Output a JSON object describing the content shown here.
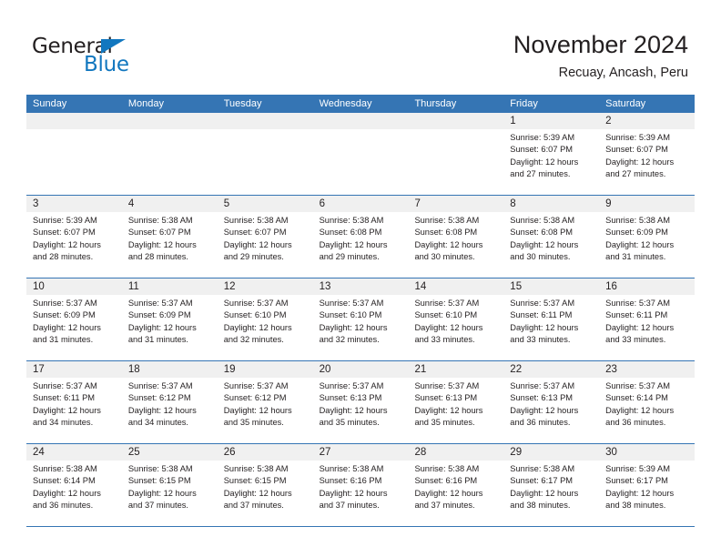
{
  "brand": {
    "name_part1": "General",
    "name_part2": "Blue",
    "triangle_icon": "triangle-icon",
    "accent_color": "#1277bf"
  },
  "header": {
    "title": "November 2024",
    "subtitle": "Recuay, Ancash, Peru"
  },
  "theme": {
    "header_band": "#3575b4",
    "day_band": "#f0f0f0",
    "text": "#231f20"
  },
  "weekdays": [
    "Sunday",
    "Monday",
    "Tuesday",
    "Wednesday",
    "Thursday",
    "Friday",
    "Saturday"
  ],
  "weeks": [
    [
      {
        "day": "",
        "empty": true,
        "sunrise": "",
        "sunset": "",
        "daylight1": "",
        "daylight2": ""
      },
      {
        "day": "",
        "empty": true,
        "sunrise": "",
        "sunset": "",
        "daylight1": "",
        "daylight2": ""
      },
      {
        "day": "",
        "empty": true,
        "sunrise": "",
        "sunset": "",
        "daylight1": "",
        "daylight2": ""
      },
      {
        "day": "",
        "empty": true,
        "sunrise": "",
        "sunset": "",
        "daylight1": "",
        "daylight2": ""
      },
      {
        "day": "",
        "empty": true,
        "sunrise": "",
        "sunset": "",
        "daylight1": "",
        "daylight2": ""
      },
      {
        "day": "1",
        "empty": false,
        "sunrise": "Sunrise: 5:39 AM",
        "sunset": "Sunset: 6:07 PM",
        "daylight1": "Daylight: 12 hours",
        "daylight2": "and 27 minutes."
      },
      {
        "day": "2",
        "empty": false,
        "sunrise": "Sunrise: 5:39 AM",
        "sunset": "Sunset: 6:07 PM",
        "daylight1": "Daylight: 12 hours",
        "daylight2": "and 27 minutes."
      }
    ],
    [
      {
        "day": "3",
        "empty": false,
        "sunrise": "Sunrise: 5:39 AM",
        "sunset": "Sunset: 6:07 PM",
        "daylight1": "Daylight: 12 hours",
        "daylight2": "and 28 minutes."
      },
      {
        "day": "4",
        "empty": false,
        "sunrise": "Sunrise: 5:38 AM",
        "sunset": "Sunset: 6:07 PM",
        "daylight1": "Daylight: 12 hours",
        "daylight2": "and 28 minutes."
      },
      {
        "day": "5",
        "empty": false,
        "sunrise": "Sunrise: 5:38 AM",
        "sunset": "Sunset: 6:07 PM",
        "daylight1": "Daylight: 12 hours",
        "daylight2": "and 29 minutes."
      },
      {
        "day": "6",
        "empty": false,
        "sunrise": "Sunrise: 5:38 AM",
        "sunset": "Sunset: 6:08 PM",
        "daylight1": "Daylight: 12 hours",
        "daylight2": "and 29 minutes."
      },
      {
        "day": "7",
        "empty": false,
        "sunrise": "Sunrise: 5:38 AM",
        "sunset": "Sunset: 6:08 PM",
        "daylight1": "Daylight: 12 hours",
        "daylight2": "and 30 minutes."
      },
      {
        "day": "8",
        "empty": false,
        "sunrise": "Sunrise: 5:38 AM",
        "sunset": "Sunset: 6:08 PM",
        "daylight1": "Daylight: 12 hours",
        "daylight2": "and 30 minutes."
      },
      {
        "day": "9",
        "empty": false,
        "sunrise": "Sunrise: 5:38 AM",
        "sunset": "Sunset: 6:09 PM",
        "daylight1": "Daylight: 12 hours",
        "daylight2": "and 31 minutes."
      }
    ],
    [
      {
        "day": "10",
        "empty": false,
        "sunrise": "Sunrise: 5:37 AM",
        "sunset": "Sunset: 6:09 PM",
        "daylight1": "Daylight: 12 hours",
        "daylight2": "and 31 minutes."
      },
      {
        "day": "11",
        "empty": false,
        "sunrise": "Sunrise: 5:37 AM",
        "sunset": "Sunset: 6:09 PM",
        "daylight1": "Daylight: 12 hours",
        "daylight2": "and 31 minutes."
      },
      {
        "day": "12",
        "empty": false,
        "sunrise": "Sunrise: 5:37 AM",
        "sunset": "Sunset: 6:10 PM",
        "daylight1": "Daylight: 12 hours",
        "daylight2": "and 32 minutes."
      },
      {
        "day": "13",
        "empty": false,
        "sunrise": "Sunrise: 5:37 AM",
        "sunset": "Sunset: 6:10 PM",
        "daylight1": "Daylight: 12 hours",
        "daylight2": "and 32 minutes."
      },
      {
        "day": "14",
        "empty": false,
        "sunrise": "Sunrise: 5:37 AM",
        "sunset": "Sunset: 6:10 PM",
        "daylight1": "Daylight: 12 hours",
        "daylight2": "and 33 minutes."
      },
      {
        "day": "15",
        "empty": false,
        "sunrise": "Sunrise: 5:37 AM",
        "sunset": "Sunset: 6:11 PM",
        "daylight1": "Daylight: 12 hours",
        "daylight2": "and 33 minutes."
      },
      {
        "day": "16",
        "empty": false,
        "sunrise": "Sunrise: 5:37 AM",
        "sunset": "Sunset: 6:11 PM",
        "daylight1": "Daylight: 12 hours",
        "daylight2": "and 33 minutes."
      }
    ],
    [
      {
        "day": "17",
        "empty": false,
        "sunrise": "Sunrise: 5:37 AM",
        "sunset": "Sunset: 6:11 PM",
        "daylight1": "Daylight: 12 hours",
        "daylight2": "and 34 minutes."
      },
      {
        "day": "18",
        "empty": false,
        "sunrise": "Sunrise: 5:37 AM",
        "sunset": "Sunset: 6:12 PM",
        "daylight1": "Daylight: 12 hours",
        "daylight2": "and 34 minutes."
      },
      {
        "day": "19",
        "empty": false,
        "sunrise": "Sunrise: 5:37 AM",
        "sunset": "Sunset: 6:12 PM",
        "daylight1": "Daylight: 12 hours",
        "daylight2": "and 35 minutes."
      },
      {
        "day": "20",
        "empty": false,
        "sunrise": "Sunrise: 5:37 AM",
        "sunset": "Sunset: 6:13 PM",
        "daylight1": "Daylight: 12 hours",
        "daylight2": "and 35 minutes."
      },
      {
        "day": "21",
        "empty": false,
        "sunrise": "Sunrise: 5:37 AM",
        "sunset": "Sunset: 6:13 PM",
        "daylight1": "Daylight: 12 hours",
        "daylight2": "and 35 minutes."
      },
      {
        "day": "22",
        "empty": false,
        "sunrise": "Sunrise: 5:37 AM",
        "sunset": "Sunset: 6:13 PM",
        "daylight1": "Daylight: 12 hours",
        "daylight2": "and 36 minutes."
      },
      {
        "day": "23",
        "empty": false,
        "sunrise": "Sunrise: 5:37 AM",
        "sunset": "Sunset: 6:14 PM",
        "daylight1": "Daylight: 12 hours",
        "daylight2": "and 36 minutes."
      }
    ],
    [
      {
        "day": "24",
        "empty": false,
        "sunrise": "Sunrise: 5:38 AM",
        "sunset": "Sunset: 6:14 PM",
        "daylight1": "Daylight: 12 hours",
        "daylight2": "and 36 minutes."
      },
      {
        "day": "25",
        "empty": false,
        "sunrise": "Sunrise: 5:38 AM",
        "sunset": "Sunset: 6:15 PM",
        "daylight1": "Daylight: 12 hours",
        "daylight2": "and 37 minutes."
      },
      {
        "day": "26",
        "empty": false,
        "sunrise": "Sunrise: 5:38 AM",
        "sunset": "Sunset: 6:15 PM",
        "daylight1": "Daylight: 12 hours",
        "daylight2": "and 37 minutes."
      },
      {
        "day": "27",
        "empty": false,
        "sunrise": "Sunrise: 5:38 AM",
        "sunset": "Sunset: 6:16 PM",
        "daylight1": "Daylight: 12 hours",
        "daylight2": "and 37 minutes."
      },
      {
        "day": "28",
        "empty": false,
        "sunrise": "Sunrise: 5:38 AM",
        "sunset": "Sunset: 6:16 PM",
        "daylight1": "Daylight: 12 hours",
        "daylight2": "and 37 minutes."
      },
      {
        "day": "29",
        "empty": false,
        "sunrise": "Sunrise: 5:38 AM",
        "sunset": "Sunset: 6:17 PM",
        "daylight1": "Daylight: 12 hours",
        "daylight2": "and 38 minutes."
      },
      {
        "day": "30",
        "empty": false,
        "sunrise": "Sunrise: 5:39 AM",
        "sunset": "Sunset: 6:17 PM",
        "daylight1": "Daylight: 12 hours",
        "daylight2": "and 38 minutes."
      }
    ]
  ]
}
